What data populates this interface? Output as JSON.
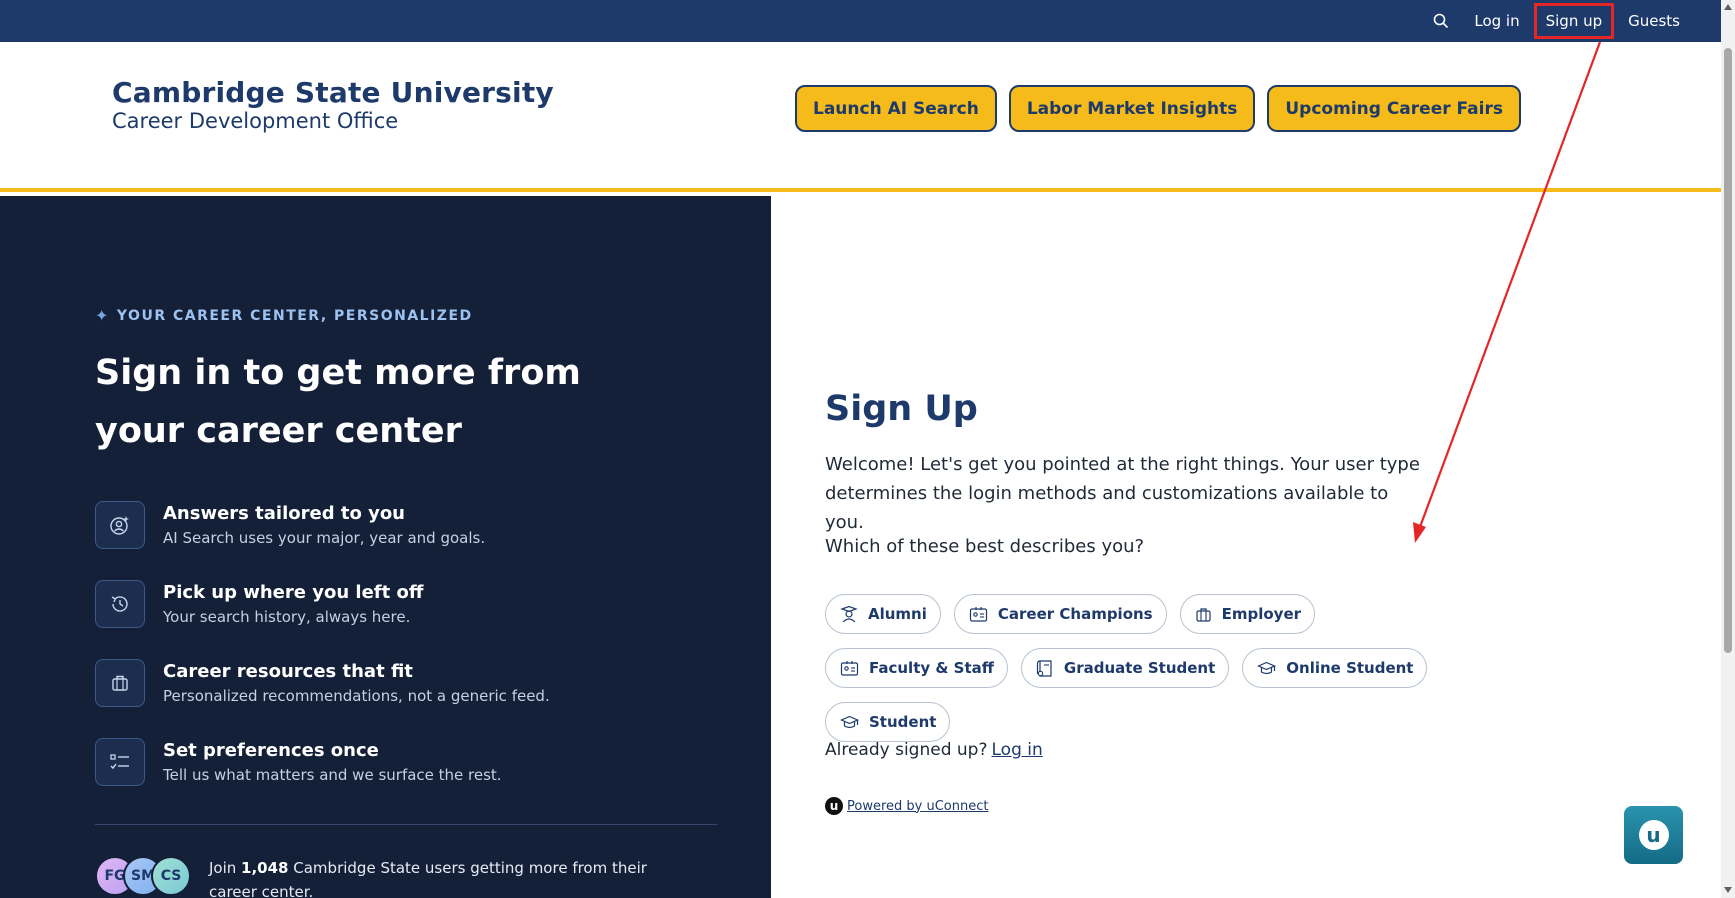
{
  "topnav": {
    "search_icon": "search-icon",
    "login_label": "Log in",
    "signup_label": "Sign up",
    "guests_label": "Guests"
  },
  "header": {
    "university": "Cambridge State University",
    "office": "Career Development Office",
    "buttons": [
      "Launch AI Search",
      "Labor Market Insights",
      "Upcoming Career Fairs"
    ]
  },
  "left": {
    "eyebrow": "YOUR CAREER CENTER, PERSONALIZED",
    "headline": "Sign in to get more from your career center",
    "features": [
      {
        "icon": "person-sparkle-icon",
        "title": "Answers tailored to you",
        "desc": "AI Search uses your major, year and goals."
      },
      {
        "icon": "history-icon",
        "title": "Pick up where you left off",
        "desc": "Your search history, always here."
      },
      {
        "icon": "briefcase-icon",
        "title": "Career resources that fit",
        "desc": "Personalized recommendations, not a generic feed."
      },
      {
        "icon": "checklist-icon",
        "title": "Set preferences once",
        "desc": "Tell us what matters and we surface the rest."
      }
    ],
    "avatars": [
      "FG",
      "SM",
      "CS"
    ],
    "join_prefix": "Join ",
    "join_count": "1,048",
    "join_suffix": " Cambridge State users getting more from their career center."
  },
  "signup": {
    "title": "Sign Up",
    "welcome": "Welcome! Let's get you pointed at the right things. Your user type determines the login methods and customizations available to you.",
    "question": "Which of these best describes you?",
    "user_types": [
      {
        "icon": "graduate-icon",
        "label": "Alumni"
      },
      {
        "icon": "id-card-icon",
        "label": "Career Champions"
      },
      {
        "icon": "briefcase-icon",
        "label": "Employer"
      },
      {
        "icon": "id-card-icon",
        "label": "Faculty & Staff"
      },
      {
        "icon": "diploma-icon",
        "label": "Graduate Student"
      },
      {
        "icon": "mortarboard-icon",
        "label": "Online Student"
      },
      {
        "icon": "mortarboard-icon",
        "label": "Student"
      }
    ],
    "already": "Already signed up?",
    "login_link": "Log in",
    "powered_logo": "u",
    "powered_by": "Powered by uConnect"
  },
  "chat_button": {
    "logo": "u"
  },
  "colors": {
    "navy": "#1e3a6b",
    "dark_panel": "#142038",
    "gold": "#f5bb1a",
    "annotation_red": "#e32626"
  }
}
